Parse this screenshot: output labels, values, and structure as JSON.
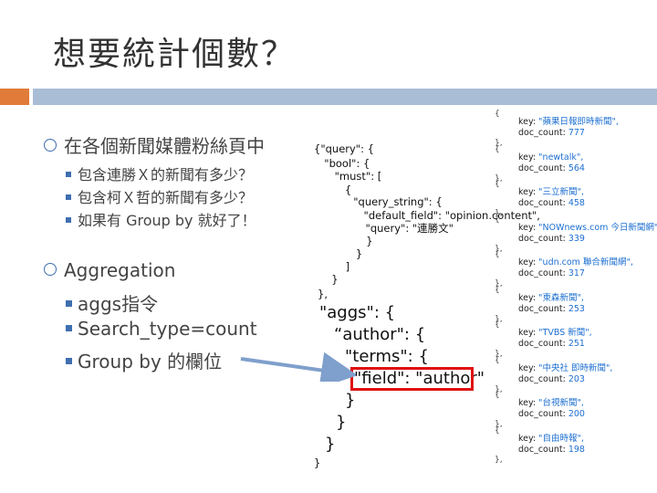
{
  "slide": {
    "title": "想要統計個數？",
    "bullets": [
      {
        "text": "在各個新聞媒體粉絲頁中",
        "subs": [
          "包含連勝Ｘ的新聞有多少？",
          "包含柯Ｘ哲的新聞有多少？",
          "如果有 Group by 就好了！"
        ]
      },
      {
        "text": "Aggregation",
        "subs": [
          "aggs指令",
          "Search_type=count",
          "Group by 的欄位"
        ]
      }
    ]
  },
  "query_small": [
    "{\"query\": {",
    "  \"bool\": {",
    "    \"must\": [",
    "      {",
    "        \"query_string\": {",
    "          \"default_field\": \"opinion.content\",",
    "          \"query\": \"連勝文\"",
    "        }",
    "      }",
    "    ]",
    "  }",
    "},"
  ],
  "query_aggs": [
    "\"aggs\": {",
    "“author\": {",
    "\"terms\": {",
    "\"field\": \"author\"",
    "}",
    "}",
    "}",
    "}"
  ],
  "results": {
    "key_label": "key:",
    "count_label": "doc_count:",
    "items": [
      {
        "key": "\"蘋果日報即時新聞\",",
        "count": "777"
      },
      {
        "key": "\"newtalk\",",
        "count": "564"
      },
      {
        "key": "\"三立新聞\",",
        "count": "458"
      },
      {
        "key": "\"NOWnews.com 今日新聞網\",",
        "count": "339"
      },
      {
        "key": "\"udn.com 聯合新聞網\",",
        "count": "317"
      },
      {
        "key": "\"東森新聞\",",
        "count": "253"
      },
      {
        "key": "\"TVBS 新聞\",",
        "count": "251"
      },
      {
        "key": "\"中央社 即時新聞\",",
        "count": "203"
      },
      {
        "key": "\"台視新聞\",",
        "count": "200"
      },
      {
        "key": "\"自由時報\",",
        "count": "198"
      }
    ]
  },
  "colors": {
    "accent_orange": "#e07b3a",
    "accent_blue": "#a9bdd6",
    "bullet_blue": "#3f6fb0",
    "highlight_red": "#e01010",
    "result_value_blue": "#1d6fd1"
  }
}
